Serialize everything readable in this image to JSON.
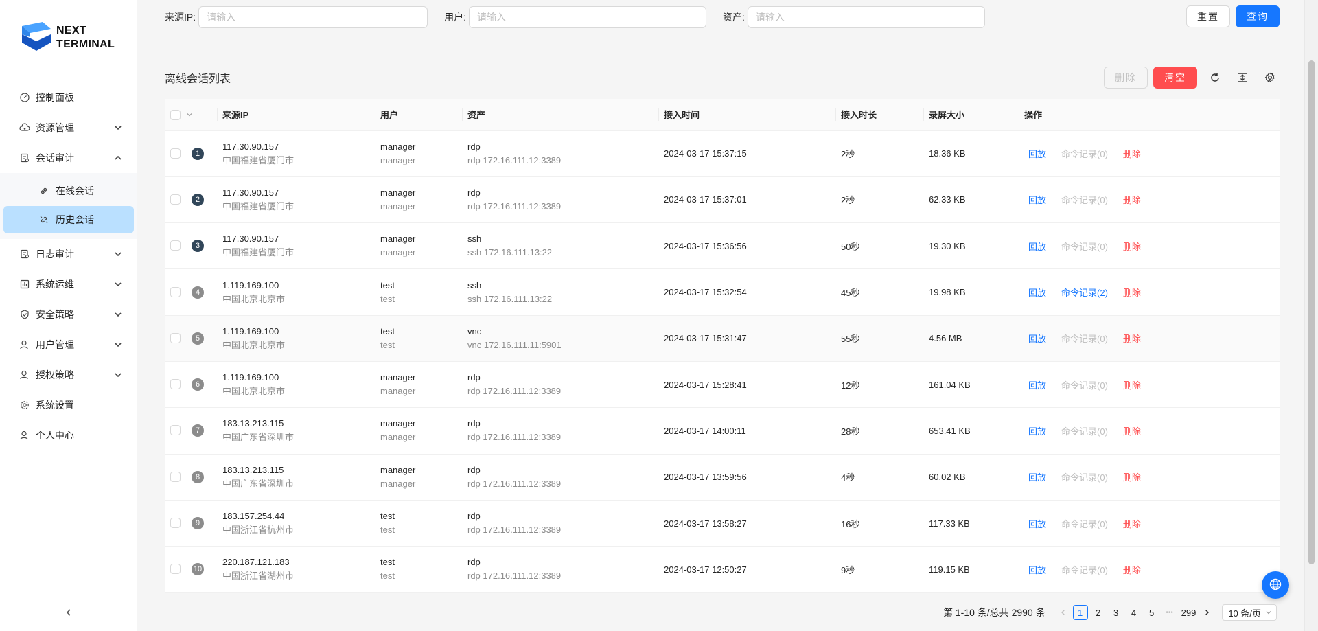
{
  "brand": {
    "line1": "NEXT",
    "line2": "TERMINAL",
    "colors": {
      "accent": "#1677ff",
      "logo_light": "#4aa3ff",
      "logo_dark": "#1554c0"
    }
  },
  "sidebar": {
    "items": [
      {
        "label": "控制面板",
        "icon": "dashboard-icon"
      },
      {
        "label": "资源管理",
        "icon": "cloud-icon"
      },
      {
        "label": "会话审计",
        "icon": "audit-icon",
        "expanded": true,
        "children": [
          {
            "label": "在线会话",
            "icon": "link-icon"
          },
          {
            "label": "历史会话",
            "icon": "unlink-icon",
            "active": true
          }
        ]
      },
      {
        "label": "日志审计",
        "icon": "log-icon"
      },
      {
        "label": "系统运维",
        "icon": "ops-icon"
      },
      {
        "label": "安全策略",
        "icon": "shield-icon"
      },
      {
        "label": "用户管理",
        "icon": "user-icon"
      },
      {
        "label": "授权策略",
        "icon": "user-icon"
      },
      {
        "label": "系统设置",
        "icon": "gear-icon"
      },
      {
        "label": "个人中心",
        "icon": "user-icon"
      }
    ]
  },
  "search": {
    "ip_label": "来源IP:",
    "ip_placeholder": "请输入",
    "user_label": "用户:",
    "user_placeholder": "请输入",
    "asset_label": "资产:",
    "asset_placeholder": "请输入",
    "reset_label": "重置",
    "query_label": "查询"
  },
  "card": {
    "title": "离线会话列表",
    "delete_label": "删除",
    "clear_label": "清空"
  },
  "table": {
    "columns": [
      "来源IP",
      "用户",
      "资产",
      "接入时间",
      "接入时长",
      "录屏大小",
      "操作"
    ],
    "ops": {
      "replay": "回放",
      "delete": "删除"
    },
    "rows": [
      {
        "idx": "1",
        "ip": "117.30.90.157",
        "loc": "中国福建省厦门市",
        "user": "manager",
        "user2": "manager",
        "asset": "rdp",
        "asset2": "rdp 172.16.111.12:3389",
        "time": "2024-03-17 15:37:15",
        "dur": "2秒",
        "size": "18.36 KB",
        "cmd": "命令记录(0)",
        "cmd_active": false
      },
      {
        "idx": "2",
        "ip": "117.30.90.157",
        "loc": "中国福建省厦门市",
        "user": "manager",
        "user2": "manager",
        "asset": "rdp",
        "asset2": "rdp 172.16.111.12:3389",
        "time": "2024-03-17 15:37:01",
        "dur": "2秒",
        "size": "62.33 KB",
        "cmd": "命令记录(0)",
        "cmd_active": false
      },
      {
        "idx": "3",
        "ip": "117.30.90.157",
        "loc": "中国福建省厦门市",
        "user": "manager",
        "user2": "manager",
        "asset": "ssh",
        "asset2": "ssh 172.16.111.13:22",
        "time": "2024-03-17 15:36:56",
        "dur": "50秒",
        "size": "19.30 KB",
        "cmd": "命令记录(0)",
        "cmd_active": false
      },
      {
        "idx": "4",
        "ip": "1.119.169.100",
        "loc": "中国北京北京市",
        "user": "test",
        "user2": "test",
        "asset": "ssh",
        "asset2": "ssh 172.16.111.13:22",
        "time": "2024-03-17 15:32:54",
        "dur": "45秒",
        "size": "19.98 KB",
        "cmd": "命令记录(2)",
        "cmd_active": true
      },
      {
        "idx": "5",
        "ip": "1.119.169.100",
        "loc": "中国北京北京市",
        "user": "test",
        "user2": "test",
        "asset": "vnc",
        "asset2": "vnc 172.16.111.11:5901",
        "time": "2024-03-17 15:31:47",
        "dur": "55秒",
        "size": "4.56 MB",
        "cmd": "命令记录(0)",
        "cmd_active": false
      },
      {
        "idx": "6",
        "ip": "1.119.169.100",
        "loc": "中国北京北京市",
        "user": "manager",
        "user2": "manager",
        "asset": "rdp",
        "asset2": "rdp 172.16.111.12:3389",
        "time": "2024-03-17 15:28:41",
        "dur": "12秒",
        "size": "161.04 KB",
        "cmd": "命令记录(0)",
        "cmd_active": false
      },
      {
        "idx": "7",
        "ip": "183.13.213.115",
        "loc": "中国广东省深圳市",
        "user": "manager",
        "user2": "manager",
        "asset": "rdp",
        "asset2": "rdp 172.16.111.12:3389",
        "time": "2024-03-17 14:00:11",
        "dur": "28秒",
        "size": "653.41 KB",
        "cmd": "命令记录(0)",
        "cmd_active": false
      },
      {
        "idx": "8",
        "ip": "183.13.213.115",
        "loc": "中国广东省深圳市",
        "user": "manager",
        "user2": "manager",
        "asset": "rdp",
        "asset2": "rdp 172.16.111.12:3389",
        "time": "2024-03-17 13:59:56",
        "dur": "4秒",
        "size": "60.02 KB",
        "cmd": "命令记录(0)",
        "cmd_active": false
      },
      {
        "idx": "9",
        "ip": "183.157.254.44",
        "loc": "中国浙江省杭州市",
        "user": "test",
        "user2": "test",
        "asset": "rdp",
        "asset2": "rdp 172.16.111.12:3389",
        "time": "2024-03-17 13:58:27",
        "dur": "16秒",
        "size": "117.33 KB",
        "cmd": "命令记录(0)",
        "cmd_active": false
      },
      {
        "idx": "10",
        "ip": "220.187.121.183",
        "loc": "中国浙江省湖州市",
        "user": "test",
        "user2": "test",
        "asset": "rdp",
        "asset2": "rdp 172.16.111.12:3389",
        "time": "2024-03-17 12:50:27",
        "dur": "9秒",
        "size": "119.15 KB",
        "cmd": "命令记录(0)",
        "cmd_active": false
      }
    ]
  },
  "pagination": {
    "total_text": "第 1-10 条/总共 2990 条",
    "pages": [
      "1",
      "2",
      "3",
      "4",
      "5"
    ],
    "ellipsis": "•••",
    "last": "299",
    "current": "1",
    "page_size": "10 条/页"
  }
}
